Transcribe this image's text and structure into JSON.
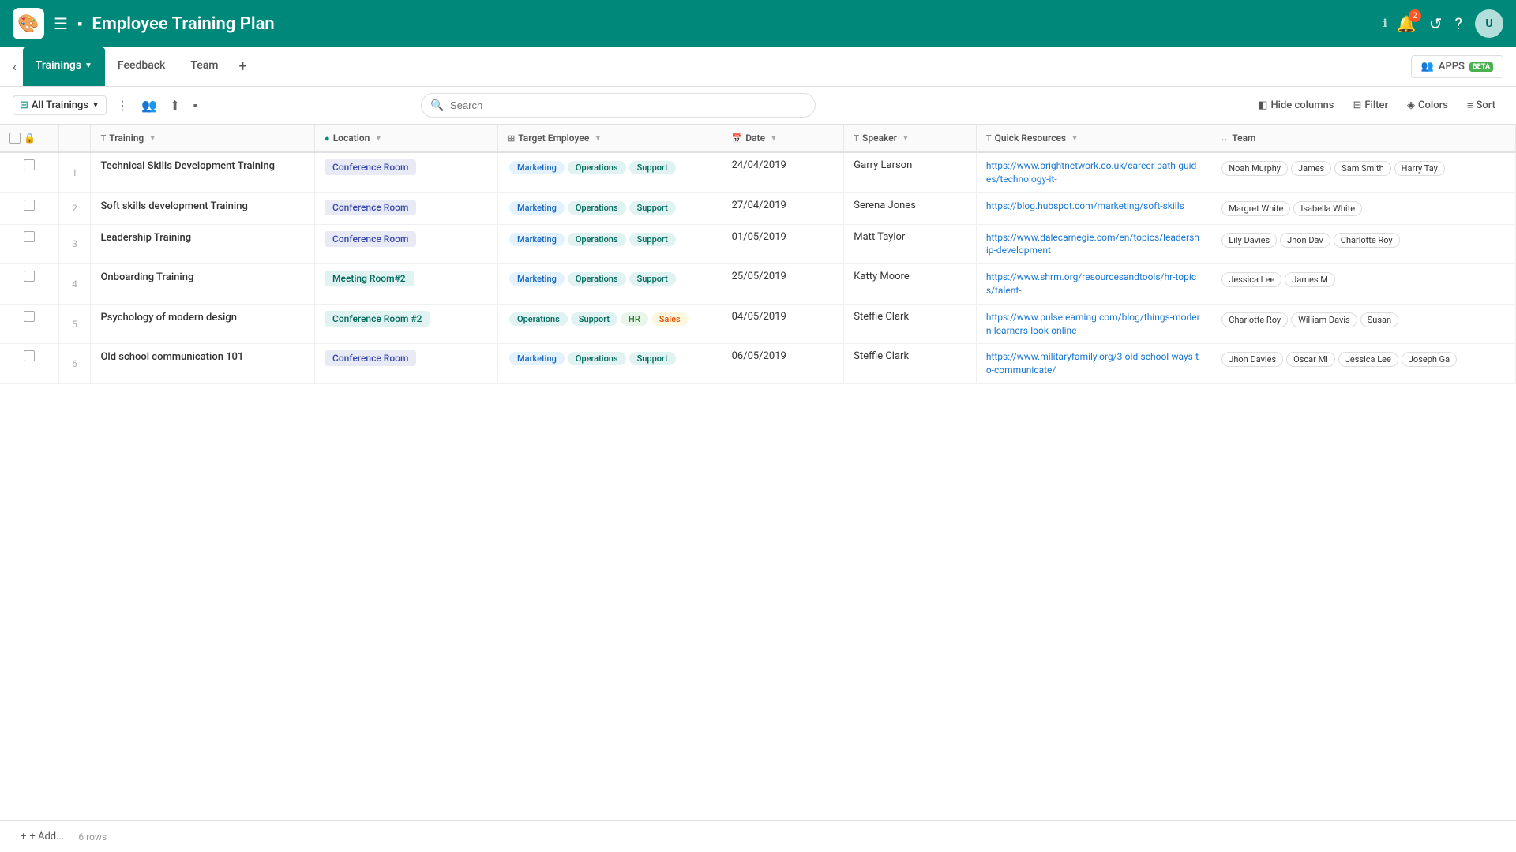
{
  "app": {
    "logo": "🎨",
    "title": "Employee Training Plan",
    "notification_count": "2"
  },
  "tabs": {
    "items": [
      {
        "label": "Trainings",
        "active": true,
        "has_dropdown": true
      },
      {
        "label": "Feedback",
        "active": false,
        "has_dropdown": false
      },
      {
        "label": "Team",
        "active": false,
        "has_dropdown": false
      }
    ],
    "add_label": "+",
    "apps_label": "APPS",
    "beta_label": "BETA"
  },
  "toolbar": {
    "view_label": "All Trainings",
    "search_placeholder": "Search",
    "hide_columns_label": "Hide columns",
    "filter_label": "Filter",
    "colors_label": "Colors",
    "sort_label": "Sort"
  },
  "table": {
    "columns": [
      {
        "id": "check",
        "label": "",
        "type": ""
      },
      {
        "id": "row_num",
        "label": "",
        "type": ""
      },
      {
        "id": "training",
        "label": "Training",
        "type": "T",
        "sortable": true
      },
      {
        "id": "location",
        "label": "Location",
        "type": "dot",
        "sortable": true
      },
      {
        "id": "target_employee",
        "label": "Target Employee",
        "type": "grid",
        "sortable": true
      },
      {
        "id": "date",
        "label": "Date",
        "type": "cal",
        "sortable": true
      },
      {
        "id": "speaker",
        "label": "Speaker",
        "type": "T",
        "sortable": true
      },
      {
        "id": "quick_resources",
        "label": "Quick Resources",
        "type": "T",
        "sortable": true
      },
      {
        "id": "team",
        "label": "Team",
        "type": "arrow",
        "sortable": false
      }
    ],
    "rows": [
      {
        "num": "1",
        "training": "Technical Skills Development Training",
        "location": "Conference Room",
        "location_type": "purple",
        "target_employees": [
          "Marketing",
          "Operations",
          "Support"
        ],
        "target_types": [
          "blue",
          "teal",
          "teal"
        ],
        "date": "24/04/2019",
        "speaker": "Garry Larson",
        "link": "https://www.brightnetwork.co.uk/career-path-guides/technology-it-",
        "team": [
          "Noah Murphy",
          "James",
          "Sam Smith",
          "Harry Tay"
        ]
      },
      {
        "num": "2",
        "training": "Soft skills development Training",
        "location": "Conference Room",
        "location_type": "purple",
        "target_employees": [
          "Marketing",
          "Operations",
          "Support"
        ],
        "target_types": [
          "blue",
          "teal",
          "teal"
        ],
        "date": "27/04/2019",
        "speaker": "Serena Jones",
        "link": "https://blog.hubspot.com/marketing/soft-skills",
        "team": [
          "Margret White",
          "Isabella White"
        ]
      },
      {
        "num": "3",
        "training": "Leadership Training",
        "location": "Conference Room",
        "location_type": "purple",
        "target_employees": [
          "Marketing",
          "Operations",
          "Support"
        ],
        "target_types": [
          "blue",
          "teal",
          "teal"
        ],
        "date": "01/05/2019",
        "speaker": "Matt Taylor",
        "link": "https://www.dalecarnegie.com/en/topics/leadership-development",
        "team": [
          "Lily Davies",
          "Jhon Dav",
          "Charlotte Roy"
        ]
      },
      {
        "num": "4",
        "training": "Onboarding Training",
        "location": "Meeting Room#2",
        "location_type": "teal",
        "target_employees": [
          "Marketing",
          "Operations",
          "Support"
        ],
        "target_types": [
          "blue",
          "teal",
          "teal"
        ],
        "date": "25/05/2019",
        "speaker": "Katty Moore",
        "link": "https://www.shrm.org/resourcesandtools/hr-topics/talent-",
        "team": [
          "Jessica Lee",
          "James M"
        ]
      },
      {
        "num": "5",
        "training": "Psychology of modern design",
        "location": "Conference Room #2",
        "location_type": "teal",
        "target_employees": [
          "Operations",
          "Support",
          "HR",
          "Sales"
        ],
        "target_types": [
          "teal",
          "teal",
          "green",
          "orange"
        ],
        "date": "04/05/2019",
        "speaker": "Steffie Clark",
        "link": "https://www.pulselearning.com/blog/things-modern-learners-look-online-",
        "team": [
          "Charlotte Roy",
          "William Davis",
          "Susan"
        ]
      },
      {
        "num": "6",
        "training": "Old school communication 101",
        "location": "Conference Room",
        "location_type": "purple",
        "target_employees": [
          "Marketing",
          "Operations",
          "Support"
        ],
        "target_types": [
          "blue",
          "teal",
          "teal"
        ],
        "date": "06/05/2019",
        "speaker": "Steffie Clark",
        "link": "https://www.militaryfamily.org/3-old-school-ways-to-communicate/",
        "team": [
          "Jhon Davies",
          "Oscar Mi",
          "Jessica Lee",
          "Joseph Ga"
        ]
      }
    ]
  },
  "bottom": {
    "add_label": "+ Add...",
    "count_label": "6 rows"
  }
}
